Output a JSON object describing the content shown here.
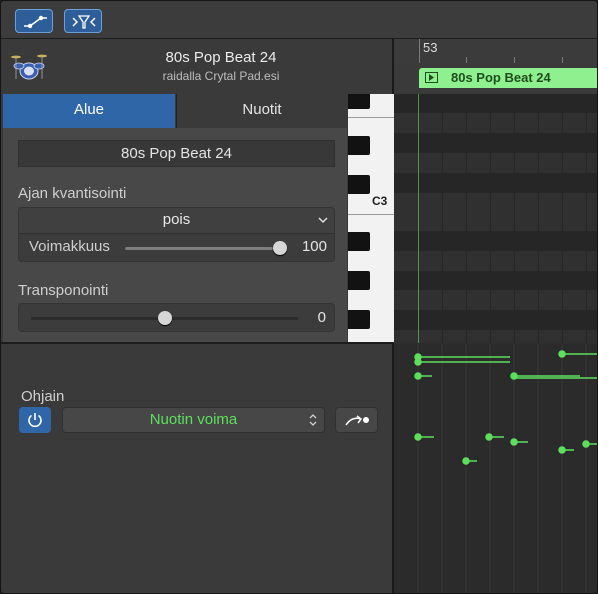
{
  "toolbar": {
    "buttons": [
      {
        "name": "automation-curve-button",
        "icon": "automation-curve-icon"
      },
      {
        "name": "midi-filter-button",
        "icon": "filter-icon"
      }
    ]
  },
  "region": {
    "title": "80s Pop Beat 24",
    "subtitle": "raidalla Crytal Pad.esi",
    "icon": "drum-kit-icon"
  },
  "tabs": [
    {
      "label": "Alue",
      "active": true
    },
    {
      "label": "Nuotit",
      "active": false
    }
  ],
  "settings": {
    "region_name": "80s Pop Beat 24",
    "quantize_label": "Ajan kvantisointi",
    "quantize_value": "pois",
    "strength_label": "Voimakkuus",
    "strength_value": "100",
    "strength_level": 1.0,
    "transpose_label": "Transponointi",
    "transpose_value": "0",
    "transpose_level": 0.5
  },
  "piano": {
    "c3_label": "C3"
  },
  "controller": {
    "label": "Ohjain",
    "select_value": "Nuotin voima",
    "accent_color": "#5ce05c"
  },
  "ruler": {
    "bar_number": "53"
  },
  "editor_region": {
    "label": "80s Pop Beat 24",
    "color": "#8ef08e"
  },
  "colors": {
    "accent_blue": "#2f66a8",
    "note_green": "#5ce05c"
  }
}
